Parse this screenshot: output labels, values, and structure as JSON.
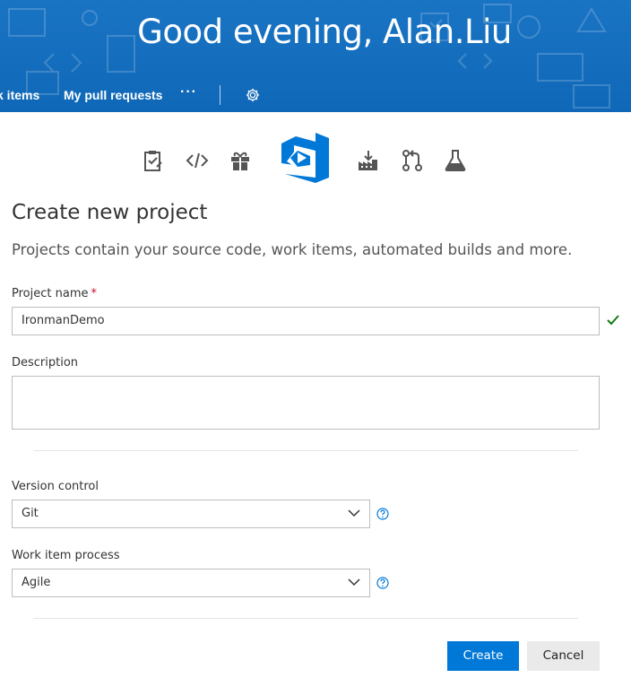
{
  "header": {
    "greeting": "Good evening, Alan.Liu",
    "nav": {
      "work_items_label": "k items",
      "pull_requests_label": "My pull requests",
      "more_label": "···"
    }
  },
  "hub_icons": [
    "work-items-icon",
    "code-icon",
    "gift-icon",
    "vsts-logo",
    "build-icon",
    "pull-request-icon",
    "test-flask-icon"
  ],
  "form": {
    "title": "Create new project",
    "subtitle": "Projects contain your source code, work items, automated builds and more.",
    "project_name": {
      "label": "Project name",
      "required_mark": "*",
      "value": "IronmanDemo"
    },
    "description": {
      "label": "Description",
      "value": ""
    },
    "version_control": {
      "label": "Version control",
      "selected": "Git"
    },
    "work_item_process": {
      "label": "Work item process",
      "selected": "Agile"
    },
    "create_label": "Create",
    "cancel_label": "Cancel"
  },
  "colors": {
    "banner": "#106ebe",
    "primary_button": "#0078d7",
    "valid_check": "#107c10",
    "help_icon": "#0078d7"
  }
}
